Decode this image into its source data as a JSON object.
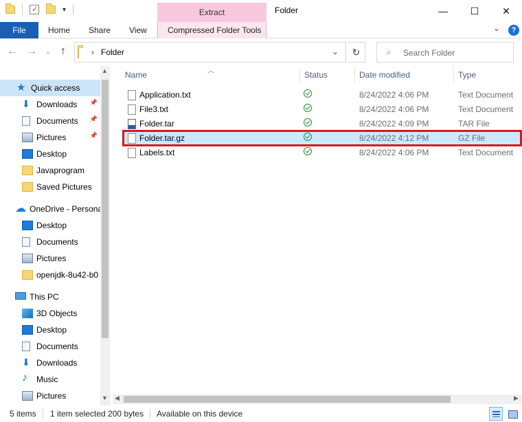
{
  "window": {
    "title": "Folder",
    "context_tab": "Extract",
    "minimize": "—",
    "maximize": "☐",
    "close": "✕"
  },
  "ribbon": {
    "file": "File",
    "tabs": [
      "Home",
      "Share",
      "View"
    ],
    "context_sub_tab": "Compressed Folder Tools",
    "help": "?",
    "collapse": "⌄"
  },
  "address": {
    "back": "←",
    "forward": "→",
    "recent": "⌄",
    "up": "↑",
    "separator": "›",
    "path": "Folder",
    "dropdown": "⌄",
    "refresh": "↻",
    "search_icon": "⌕",
    "search_placeholder": "Search Folder"
  },
  "nav": {
    "items": [
      {
        "label": "Quick access",
        "icon": "star-icon",
        "pinned": false
      },
      {
        "label": "Downloads",
        "icon": "downloads-icon",
        "pinned": true
      },
      {
        "label": "Documents",
        "icon": "documents-icon",
        "pinned": true
      },
      {
        "label": "Pictures",
        "icon": "pictures-icon",
        "pinned": true
      },
      {
        "label": "Desktop",
        "icon": "desktop-icon",
        "pinned": false
      },
      {
        "label": "Javaprogram",
        "icon": "folder-icon",
        "pinned": false
      },
      {
        "label": "Saved Pictures",
        "icon": "folder-icon",
        "pinned": false
      },
      {
        "label": "OneDrive - Persona",
        "icon": "cloud-icon",
        "pinned": false
      },
      {
        "label": "Desktop",
        "icon": "desktop-icon",
        "pinned": false
      },
      {
        "label": "Documents",
        "icon": "documents-icon",
        "pinned": false
      },
      {
        "label": "Pictures",
        "icon": "pictures-icon",
        "pinned": false
      },
      {
        "label": "openjdk-8u42-b0",
        "icon": "zip-folder-icon",
        "pinned": false
      },
      {
        "label": "This PC",
        "icon": "computer-icon",
        "pinned": false
      },
      {
        "label": "3D Objects",
        "icon": "3d-objects-icon",
        "pinned": false
      },
      {
        "label": "Desktop",
        "icon": "desktop-icon",
        "pinned": false
      },
      {
        "label": "Documents",
        "icon": "documents-icon",
        "pinned": false
      },
      {
        "label": "Downloads",
        "icon": "downloads-icon",
        "pinned": false
      },
      {
        "label": "Music",
        "icon": "music-icon",
        "pinned": false
      },
      {
        "label": "Pictures",
        "icon": "pictures-icon",
        "pinned": false
      }
    ],
    "pin_glyph": "📌"
  },
  "columns": {
    "name": "Name",
    "status": "Status",
    "date": "Date modified",
    "type": "Type"
  },
  "files": [
    {
      "name": "Application.txt",
      "date": "8/24/2022 4:06 PM",
      "type": "Text Document",
      "selected": false
    },
    {
      "name": "File3.txt",
      "date": "8/24/2022 4:06 PM",
      "type": "Text Document",
      "selected": false
    },
    {
      "name": "Folder.tar",
      "date": "8/24/2022 4:09 PM",
      "type": "TAR File",
      "selected": false
    },
    {
      "name": "Folder.tar.gz",
      "date": "8/24/2022 4:12 PM",
      "type": "GZ File",
      "selected": true
    },
    {
      "name": "Labels.txt",
      "date": "8/24/2022 4:06 PM",
      "type": "Text Document",
      "selected": false
    }
  ],
  "status": {
    "count": "5 items",
    "selection": "1 item selected  200 bytes",
    "availability": "Available on this device"
  },
  "colors": {
    "accent": "#1a5fb4",
    "selection": "#cce8ff",
    "highlight_border": "#e0141c",
    "context_tab": "#f8c8df"
  }
}
